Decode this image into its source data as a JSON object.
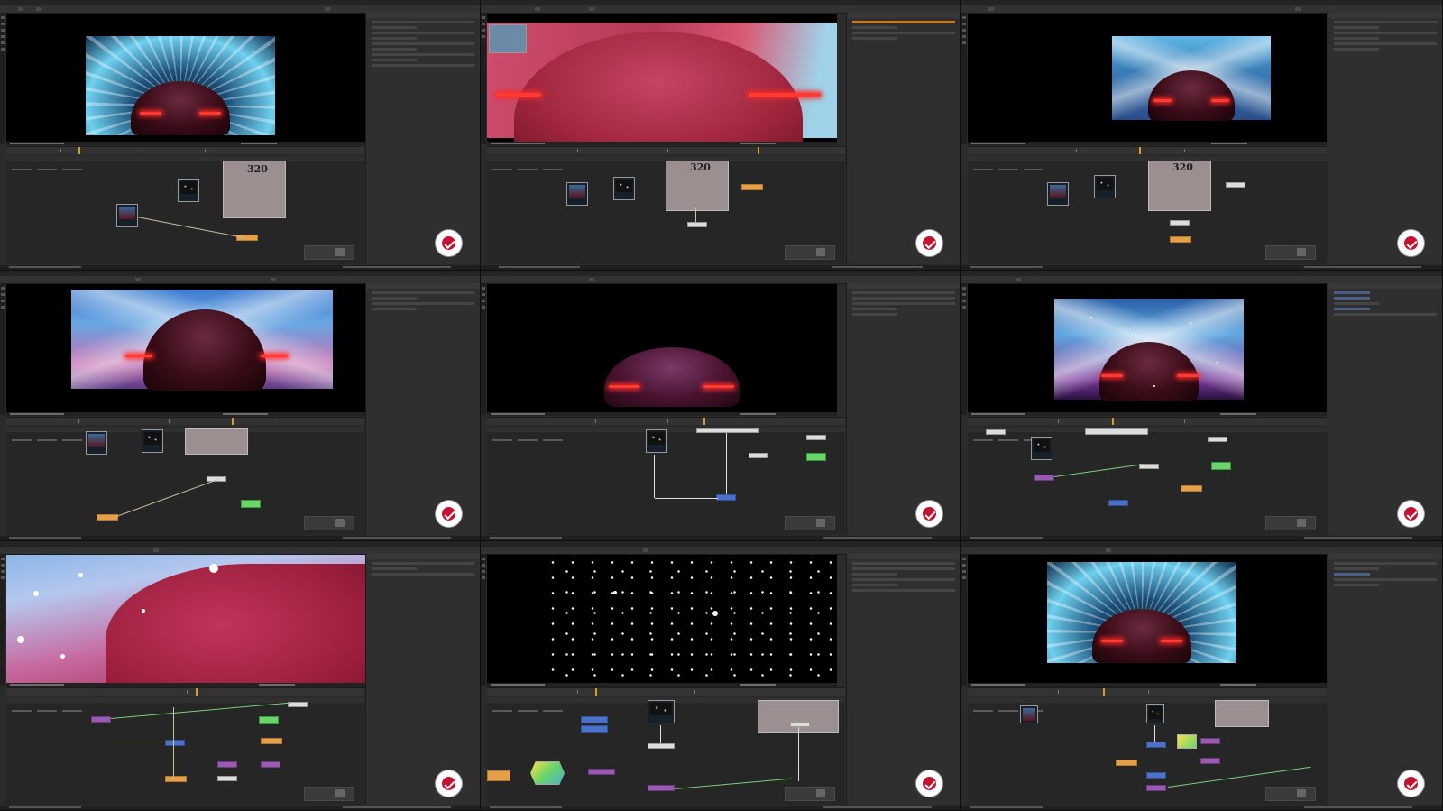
{
  "page": {
    "columns": 3,
    "rows": 3
  },
  "colors": {
    "accent_orange": "#e39a25",
    "brand_red": "#c41230",
    "node_green": "#6ad56a",
    "node_blue": "#4b72c8",
    "node_purple": "#9a5ab0",
    "node_peach": "#e5a04a"
  },
  "badge_icon": "channel-logo-icon",
  "tiles": [
    {
      "id": 1,
      "viewer_scene": "warp-streaks-car",
      "backdrop_text": "320"
    },
    {
      "id": 2,
      "viewer_scene": "car-closeup-pink",
      "backdrop_text": "320"
    },
    {
      "id": 3,
      "viewer_scene": "light-beams-car",
      "backdrop_text": "320"
    },
    {
      "id": 4,
      "viewer_scene": "light-beams-car-wide"
    },
    {
      "id": 5,
      "viewer_scene": "car-dark-background"
    },
    {
      "id": 6,
      "viewer_scene": "beams-car-snow"
    },
    {
      "id": 7,
      "viewer_scene": "car-side-snow-closeup"
    },
    {
      "id": 8,
      "viewer_scene": "starfield-particles"
    },
    {
      "id": 9,
      "viewer_scene": "warp-streaks-car"
    }
  ]
}
